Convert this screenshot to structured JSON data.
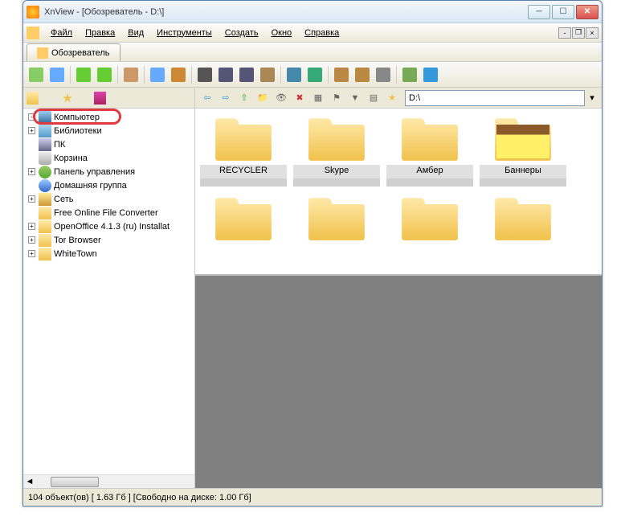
{
  "window": {
    "title": "XnView - [Обозреватель - D:\\]"
  },
  "menu": {
    "file": "Файл",
    "edit": "Правка",
    "view": "Вид",
    "tools": "Инструменты",
    "create": "Создать",
    "window": "Окно",
    "help": "Справка"
  },
  "tab": {
    "label": "Обозреватель"
  },
  "path": {
    "value": "D:\\"
  },
  "tree": {
    "items": [
      {
        "label": "Компьютер",
        "icon": "ic-computer",
        "expand": "-",
        "hl": true,
        "indent": 0
      },
      {
        "label": "Библиотеки",
        "icon": "ic-lib",
        "expand": "+",
        "indent": 0
      },
      {
        "label": "ПК",
        "icon": "ic-pc",
        "expand": "",
        "indent": 0
      },
      {
        "label": "Корзина",
        "icon": "ic-trash",
        "expand": "",
        "indent": 0
      },
      {
        "label": "Панель управления",
        "icon": "ic-cpanel",
        "expand": "+",
        "indent": 0
      },
      {
        "label": "Домашняя группа",
        "icon": "ic-home",
        "expand": "",
        "indent": 0
      },
      {
        "label": "Сеть",
        "icon": "ic-net",
        "expand": "+",
        "indent": 0
      },
      {
        "label": "Free Online File Converter",
        "icon": "ic-folder",
        "expand": "",
        "indent": 0
      },
      {
        "label": "OpenOffice 4.1.3 (ru) Installat",
        "icon": "ic-folder",
        "expand": "+",
        "indent": 0
      },
      {
        "label": "Tor Browser",
        "icon": "ic-folder",
        "expand": "+",
        "indent": 0
      },
      {
        "label": "WhiteTown",
        "icon": "ic-folder",
        "expand": "+",
        "indent": 0
      }
    ]
  },
  "folders": [
    {
      "label": "RECYCLER",
      "variant": ""
    },
    {
      "label": "Skype",
      "variant": ""
    },
    {
      "label": "Амбер",
      "variant": ""
    },
    {
      "label": "Баннеры",
      "variant": "banners"
    },
    {
      "label": "",
      "variant": ""
    },
    {
      "label": "",
      "variant": ""
    },
    {
      "label": "",
      "variant": ""
    },
    {
      "label": "",
      "variant": ""
    }
  ],
  "status": {
    "objects": "104 объект(ов)",
    "size": "[ 1.63 Гб ]",
    "free": "[Свободно на диске: 1.00 Гб]"
  },
  "toolbar_icons": [
    "open",
    "slideshow",
    "",
    "reload",
    "reload-sub",
    "",
    "convert",
    "",
    "acquire",
    "export",
    "",
    "find",
    "print",
    "print-multi",
    "multi",
    "",
    "camera",
    "web",
    "",
    "clipboard",
    "import",
    "hex",
    "",
    "settings",
    "info"
  ],
  "nav_icons": [
    "back",
    "forward",
    "up",
    "new-folder",
    "show",
    "delete",
    "view-mode",
    "sort",
    "filter",
    "layout",
    "favorites"
  ]
}
